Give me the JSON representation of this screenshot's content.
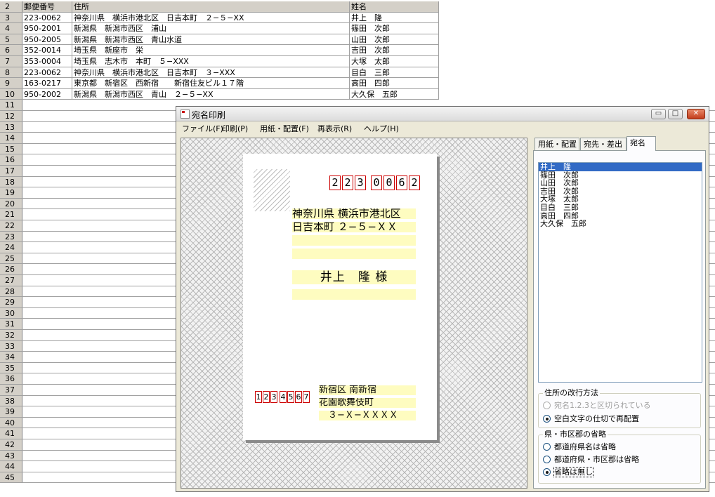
{
  "sheet": {
    "header": {
      "row": "2",
      "zip": "郵便番号",
      "addr": "住所",
      "name": "姓名"
    },
    "rows": [
      {
        "row": "3",
        "zip": "223-0062",
        "addr": "神奈川県　横浜市港北区　日吉本町　２−５−XX",
        "name": "井上　隆"
      },
      {
        "row": "4",
        "zip": "950-2001",
        "addr": "新潟県　新潟市西区　浦山",
        "name": "篠田　次郎"
      },
      {
        "row": "5",
        "zip": "950-2005",
        "addr": "新潟県　新潟市西区　青山水道",
        "name": "山田　次郎"
      },
      {
        "row": "6",
        "zip": "352-0014",
        "addr": "埼玉県　新座市　栄",
        "name": "吉田　次郎"
      },
      {
        "row": "7",
        "zip": "353-0004",
        "addr": "埼玉県　志木市　本町　５−XXX",
        "name": "大塚　太郎"
      },
      {
        "row": "8",
        "zip": "223-0062",
        "addr": "神奈川県　横浜市港北区　日吉本町　３−XXX",
        "name": "目白　三郎"
      },
      {
        "row": "9",
        "zip": "163-0217",
        "addr": "東京都　新宿区　西新宿　　新宿住友ビル１７階",
        "name": "高田　四郎"
      },
      {
        "row": "10",
        "zip": "950-2002",
        "addr": "新潟県　新潟市西区　青山　２−５−XX",
        "name": "大久保　五郎"
      }
    ],
    "empty_rows": [
      "11",
      "12",
      "13",
      "14",
      "15",
      "16",
      "17",
      "18",
      "19",
      "20",
      "21",
      "22",
      "23",
      "24",
      "25",
      "26",
      "27",
      "28",
      "29",
      "30",
      "31",
      "32",
      "33",
      "34",
      "35",
      "36",
      "37",
      "38",
      "39",
      "40",
      "41",
      "42",
      "43",
      "44",
      "45"
    ]
  },
  "window": {
    "title": "宛名印刷",
    "controls": {
      "minimize": "▭",
      "maximize": "□",
      "close": "✕"
    },
    "menu": [
      "ファイル(F)",
      "印刷(P)",
      "用紙・配置(F)",
      "再表示(R)",
      "ヘルプ(H)"
    ]
  },
  "postcard": {
    "zip_digits": [
      "2",
      "2",
      "3",
      "0",
      "0",
      "6",
      "2"
    ],
    "address_lines": [
      "神奈川県 横浜市港北区",
      "日吉本町 ２−５−ＸＸ",
      "",
      ""
    ],
    "recipient": "井上　隆 様",
    "sender_zip_digits": [
      "1",
      "2",
      "3",
      "4",
      "5",
      "6",
      "7"
    ],
    "sender_lines": [
      "新宿区 南新宿",
      "花園歌舞伎町",
      "　３−Ｘ−ＸＸＸＸ"
    ]
  },
  "panel": {
    "tabs": [
      "用紙・配置",
      "宛先・差出",
      "宛名"
    ],
    "active_tab": 2,
    "names": [
      "井上　隆",
      "篠田　次郎",
      "山田　次郎",
      "吉田　次郎",
      "大塚　太郎",
      "目白　三郎",
      "高田　四郎",
      "大久保　五郎"
    ],
    "selected_index": 0,
    "linebreak_group": {
      "title": "住所の改行方法",
      "options": [
        "宛名1.2.3と区切られている",
        "空白文字の仕切で再配置"
      ]
    },
    "omit_group": {
      "title": "県・市区郡の省略",
      "options": [
        "都道府県名は省略",
        "都道府県・市区郡は省略",
        "省略は無し"
      ]
    }
  },
  "colors": {
    "accent": "#316ac5",
    "zip_box": "#cc0000",
    "field_fill": "#fefcc0"
  }
}
